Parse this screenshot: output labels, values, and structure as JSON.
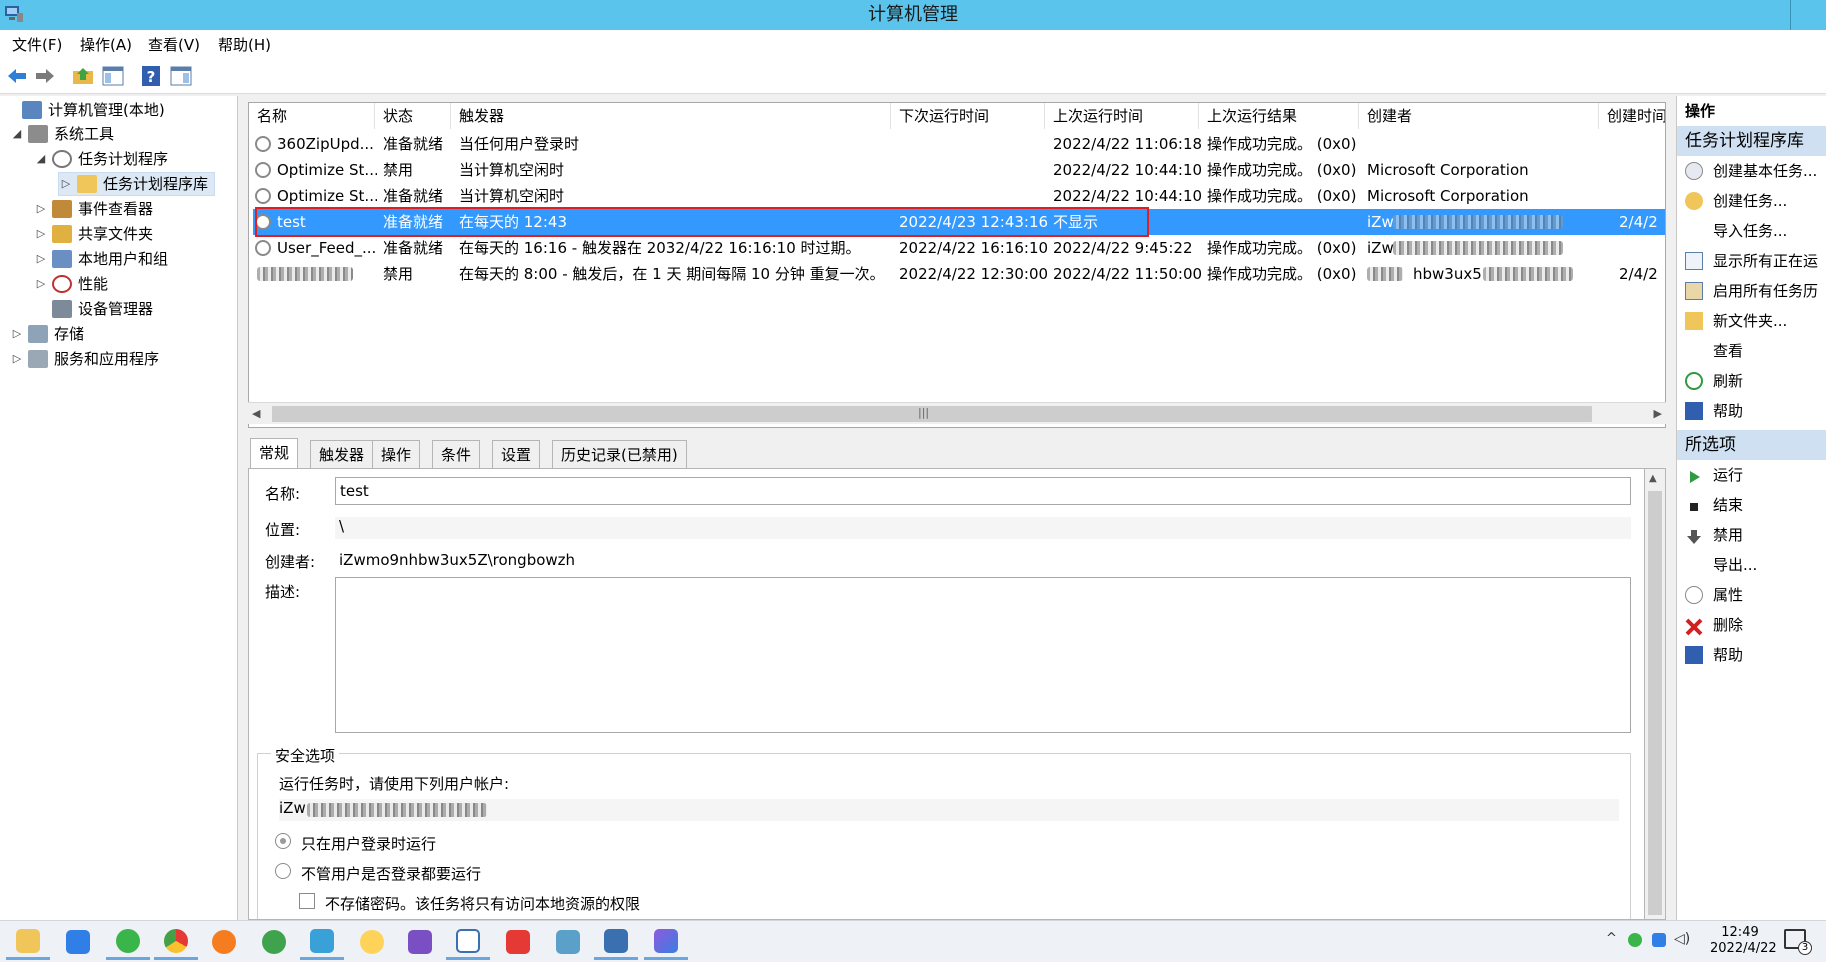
{
  "window": {
    "title": "计算机管理"
  },
  "menu": [
    "文件(F)",
    "操作(A)",
    "查看(V)",
    "帮助(H)"
  ],
  "tree": [
    {
      "label": "计算机管理(本地)",
      "exp": ""
    },
    {
      "label": "系统工具",
      "exp": "◢"
    },
    {
      "label": "任务计划程序",
      "exp": "◢"
    },
    {
      "label": "任务计划程序库",
      "exp": "▷"
    },
    {
      "label": "事件查看器",
      "exp": "▷"
    },
    {
      "label": "共享文件夹",
      "exp": "▷"
    },
    {
      "label": "本地用户和组",
      "exp": "▷"
    },
    {
      "label": "性能",
      "exp": "▷"
    },
    {
      "label": "设备管理器",
      "exp": ""
    },
    {
      "label": "存储",
      "exp": "▷"
    },
    {
      "label": "服务和应用程序",
      "exp": "▷"
    }
  ],
  "columns": [
    "名称",
    "状态",
    "触发器",
    "下次运行时间",
    "上次运行时间",
    "上次运行结果",
    "创建者",
    "创建时间"
  ],
  "tasks": [
    {
      "name": "360ZipUpd...",
      "status": "准备就绪",
      "trigger": "当任何用户登录时",
      "next": "",
      "last": "2022/4/22 11:06:18",
      "result": "操作成功完成。 (0x0)",
      "author": "",
      "created": ""
    },
    {
      "name": "Optimize St...",
      "status": "禁用",
      "trigger": "当计算机空闲时",
      "next": "",
      "last": "2022/4/22 10:44:10",
      "result": "操作成功完成。 (0x0)",
      "author": "Microsoft Corporation",
      "created": ""
    },
    {
      "name": "Optimize St...",
      "status": "准备就绪",
      "trigger": "当计算机空闲时",
      "next": "",
      "last": "2022/4/22 10:44:10",
      "result": "操作成功完成。 (0x0)",
      "author": "Microsoft Corporation",
      "created": ""
    },
    {
      "name": "test",
      "status": "准备就绪",
      "trigger": "在每天的 12:43",
      "next": "2022/4/23 12:43:16",
      "last": "不显示",
      "result": "",
      "author": "iZw",
      "created": "2/4/2"
    },
    {
      "name": "User_Feed_...",
      "status": "准备就绪",
      "trigger": "在每天的 16:16 - 触发器在 2032/4/22 16:16:10 时过期。",
      "next": "2022/4/22 16:16:10",
      "last": "2022/4/22 9:45:22",
      "result": "操作成功完成。 (0x0)",
      "author": "iZw",
      "created": ""
    },
    {
      "name": "",
      "status": "禁用",
      "trigger": "在每天的 8:00 - 触发后，在 1 天 期间每隔 10 分钟 重复一次。",
      "next": "2022/4/22 12:30:00",
      "last": "2022/4/22 11:50:00",
      "result": "操作成功完成。 (0x0)",
      "author": "hbw3ux5",
      "created": "2/4/2"
    }
  ],
  "tabs": [
    "常规",
    "触发器",
    "操作",
    "条件",
    "设置",
    "历史记录(已禁用)"
  ],
  "general": {
    "name_label": "名称:",
    "name_value": "test",
    "location_label": "位置:",
    "location_value": "\\",
    "author_label": "创建者:",
    "author_value": "iZwmo9nhbw3ux5Z\\rongbowzh",
    "desc_label": "描述:",
    "security_title": "安全选项",
    "run_as_text": "运行任务时，请使用下列用户帐户:",
    "run_as_user": "iZw",
    "radio1": "只在用户登录时运行",
    "radio2": "不管用户是否登录都要运行",
    "checkbox1": "不存储密码。该任务将只有访问本地资源的权限"
  },
  "actions": {
    "header": "操作",
    "section1": "任务计划程序库",
    "items1": [
      "创建基本任务...",
      "创建任务...",
      "导入任务...",
      "显示所有正在运",
      "启用所有任务历",
      "新文件夹...",
      "查看",
      "刷新",
      "帮助"
    ],
    "section2": "所选项",
    "items2": [
      "运行",
      "结束",
      "禁用",
      "导出...",
      "属性",
      "删除",
      "帮助"
    ]
  },
  "taskbar": {
    "time": "12:49",
    "date": "2022/4/22",
    "notif_count": "3"
  },
  "colors": {
    "title_bar": "#5bc4ec",
    "selection": "#3399ff",
    "highlight_box": "#e02020",
    "action_header": "#cfe0f3"
  }
}
